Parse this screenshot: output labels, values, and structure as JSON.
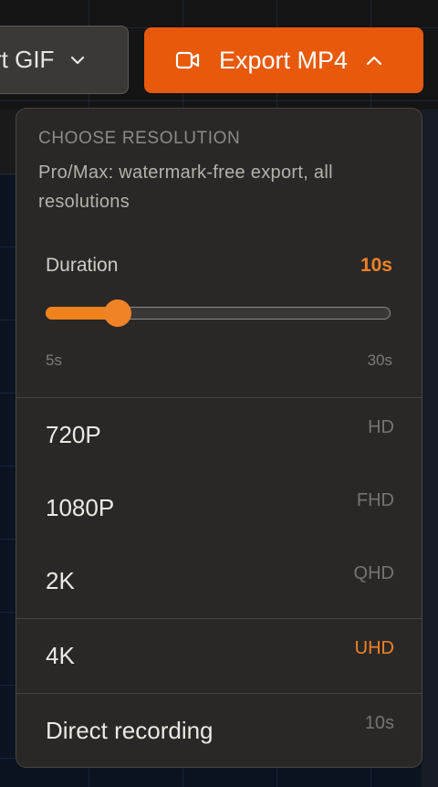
{
  "toolbar": {
    "gif_button_label": "rt GIF",
    "mp4_button_label": "Export MP4"
  },
  "dropdown": {
    "heading": "CHOOSE RESOLUTION",
    "description": "Pro/Max: watermark-free export, all resolutions",
    "duration": {
      "label": "Duration",
      "value_label": "10s",
      "min_label": "5s",
      "max_label": "30s",
      "min": 5,
      "max": 30,
      "value": 10
    },
    "options": [
      {
        "name": "720P",
        "tag": "HD"
      },
      {
        "name": "1080P",
        "tag": "FHD"
      },
      {
        "name": "2K",
        "tag": "QHD"
      },
      {
        "name": "4K",
        "tag": "UHD"
      },
      {
        "name": "Direct recording",
        "tag": "10s"
      }
    ]
  },
  "colors": {
    "accent": "#e8590c",
    "highlight": "#f08228",
    "panel_bg": "#2a2826"
  }
}
